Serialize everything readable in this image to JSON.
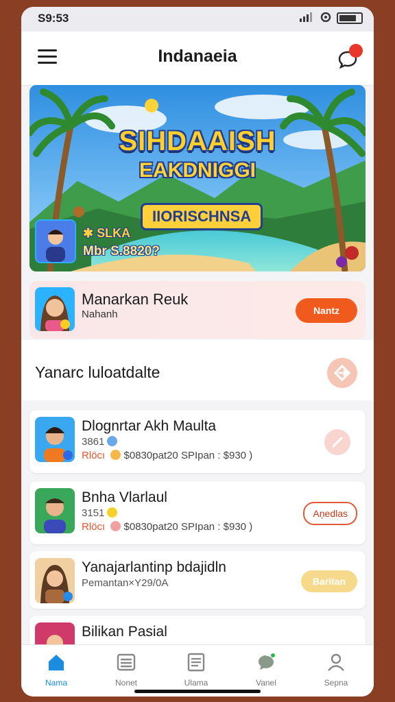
{
  "status_bar": {
    "time": "S9:53",
    "icons": [
      "signal-icon",
      "wifi-icon",
      "battery-icon"
    ]
  },
  "header": {
    "title": "Indanaeia",
    "notification_count": ""
  },
  "banner": {
    "title": "SIHDAAISH",
    "subtitle": "EAKDNIGGI",
    "plaque": "IIORISCHNSA",
    "label1": "✱ SLKA",
    "label2": "Mbr S.8820?"
  },
  "promo": {
    "title": "Manarkan Reuk",
    "subtitle": "Nahanh",
    "button": "Nantz"
  },
  "section": {
    "title": "Yanarc luloatdalte"
  },
  "list": [
    {
      "title": "Dlognrtar Akh Maulta",
      "meta1": "3861",
      "meta2_em": "Rlöcı",
      "meta2": "$0830pat20 SPIpan : $930 )",
      "action": ""
    },
    {
      "title": "Bnha Vlarlaul",
      "meta1": "3151",
      "meta2_em": "Rlöcı",
      "meta2": "$0830pat20 SPIpan : $930 )",
      "action": "Aņedlas"
    },
    {
      "title": "Yanajarlantinp bdajidln",
      "meta1": "Pemantan×Y29/0A",
      "meta2_em": "",
      "meta2": "",
      "action": "Baritan"
    },
    {
      "title": "Bilikan Pasial",
      "meta1": "",
      "meta2_em": "",
      "meta2": "",
      "action": ""
    }
  ],
  "tabs": [
    {
      "label": "Nama",
      "icon": "home-icon",
      "active": true
    },
    {
      "label": "Nonet",
      "icon": "list-icon",
      "active": false
    },
    {
      "label": "Ulama",
      "icon": "notes-icon",
      "active": false
    },
    {
      "label": "Vanel",
      "icon": "chat-bubble-icon",
      "active": false
    },
    {
      "label": "Sepna",
      "icon": "profile-icon",
      "active": false
    }
  ],
  "colors": {
    "accent": "#f05a1c",
    "tab_active": "#1b8de0",
    "background": "#8a3f24"
  }
}
